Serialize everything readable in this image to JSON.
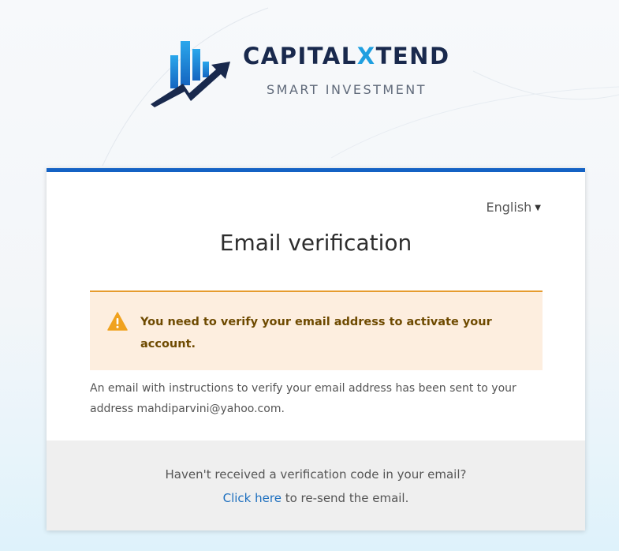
{
  "brand": {
    "name_before": "CAPITAL",
    "name_x": "X",
    "name_after": "TEND",
    "tagline": "SMART INVESTMENT",
    "colors": {
      "navy": "#19294d",
      "accent_blue": "#1f9fe0"
    }
  },
  "card": {
    "accent_color": "#1462c4",
    "language": {
      "selected": "English",
      "icon": "caret-down-icon"
    },
    "title": "Email verification",
    "alert": {
      "icon": "warning-triangle-icon",
      "text": "You need to verify your email address to activate your account.",
      "colors": {
        "background": "#fdeedf",
        "border": "#e69b2e",
        "text": "#6e4a00"
      }
    },
    "info_text": "An email with instructions to verify your email address has been sent to your address mahdiparvini@yahoo.com.",
    "footer": {
      "question": "Haven't received a verification code in your email?",
      "resend_link": "Click here",
      "resend_suffix": " to re-send the email."
    }
  }
}
